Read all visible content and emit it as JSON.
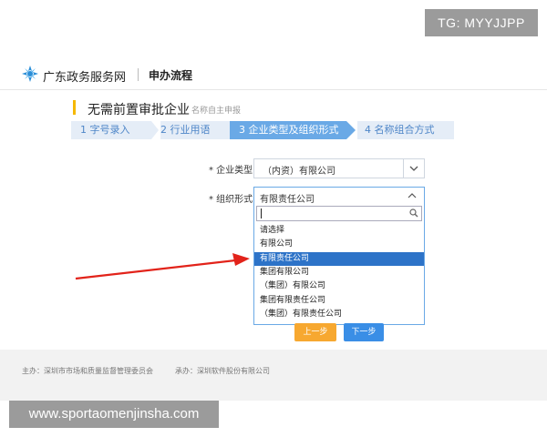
{
  "watermark": {
    "top": "TG: MYYJJPP",
    "bottom": "www.sportaomenjinsha.com"
  },
  "header": {
    "site_name": "广东政务服务网",
    "section": "申办流程"
  },
  "page": {
    "title": "无需前置审批企业",
    "subtitle": "名称自主申报"
  },
  "steps": [
    {
      "label": "1 字号录入",
      "active": false
    },
    {
      "label": "2 行业用语",
      "active": false
    },
    {
      "label": "3 企业类型及组织形式",
      "active": true
    },
    {
      "label": "4 名称组合方式",
      "active": false
    }
  ],
  "form": {
    "company_type_label": "* 企业类型",
    "company_type_value": "（内资）有限公司",
    "org_form_label": "* 组织形式",
    "org_form_value": "有限责任公司",
    "search_value": ""
  },
  "dropdown_options": [
    {
      "label": "请选择",
      "selected": false
    },
    {
      "label": "有限公司",
      "selected": false
    },
    {
      "label": "有限责任公司",
      "selected": true
    },
    {
      "label": "集团有限公司",
      "selected": false
    },
    {
      "label": "（集团）有限公司",
      "selected": false
    },
    {
      "label": "集团有限责任公司",
      "selected": false
    },
    {
      "label": "（集团）有限责任公司",
      "selected": false
    }
  ],
  "buttons": {
    "prev": "上一步",
    "next": "下一步"
  },
  "footer": {
    "sponsor": "主办：深圳市市场和质量监督管理委员会",
    "support": "承办：深圳软件股份有限公司"
  },
  "colors": {
    "accent": "#3a8ee6",
    "step_active": "#6aa9e6",
    "highlight": "#2d73c8",
    "prev_button": "#f7a830",
    "arrow": "#e2231a"
  },
  "icons": [
    "logo-icon",
    "chevron-down-icon",
    "chevron-up-icon",
    "search-icon",
    "red-arrow-icon"
  ]
}
